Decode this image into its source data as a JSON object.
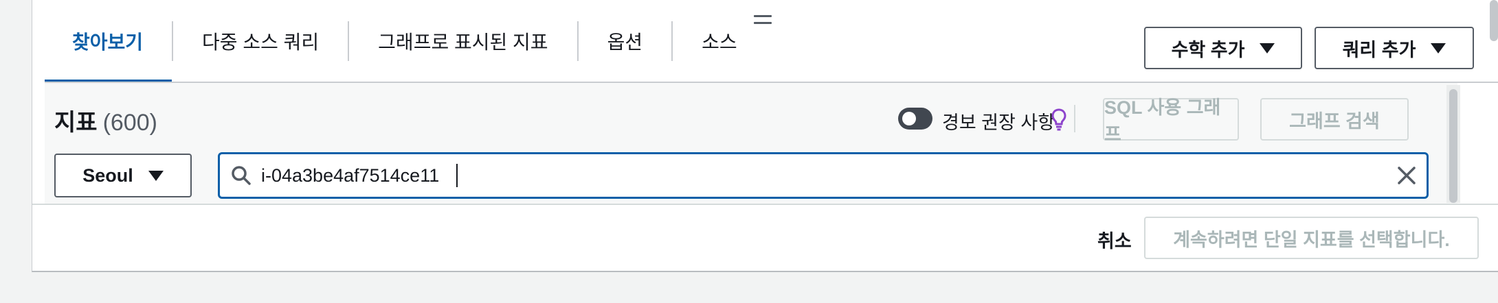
{
  "tabs": [
    {
      "label": "찾아보기",
      "active": true
    },
    {
      "label": "다중 소스 쿼리",
      "active": false
    },
    {
      "label": "그래프로 표시된 지표",
      "active": false
    },
    {
      "label": "옵션",
      "active": false
    },
    {
      "label": "소스",
      "active": false
    }
  ],
  "toolbar": {
    "math_label": "수학 추가",
    "query_label": "쿼리 추가"
  },
  "metrics": {
    "title": "지표",
    "count": "(600)",
    "alarm_toggle_label": "경보 권장 사항",
    "alarm_toggle_on": false,
    "sql_graph_label": "SQL 사용 그래프",
    "graph_search_label": "그래프 검색"
  },
  "region": {
    "selected": "Seoul"
  },
  "search": {
    "value": "i-04a3be4af7514ce11"
  },
  "footer": {
    "cancel_label": "취소",
    "continue_label": "계속하려면 단일 지표를 선택합니다."
  },
  "colors": {
    "accent": "#0a5fa8",
    "disabled_text": "#aab7b8",
    "bulb": "#8d44cc"
  },
  "icons": [
    "drag-handle-icon",
    "caret-down-icon",
    "lightbulb-icon",
    "search-icon",
    "clear-icon"
  ]
}
